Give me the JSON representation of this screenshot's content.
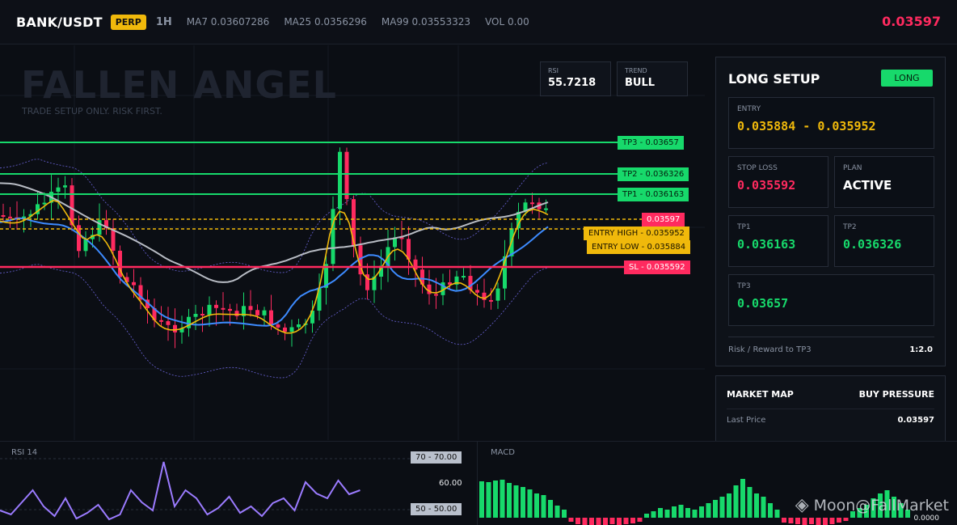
{
  "header": {
    "pair": "BANK/USDT",
    "badge": "PERP",
    "timeframe": "1H",
    "ma7": "MA7 0.03607286",
    "ma25": "MA25 0.0356296",
    "ma99": "MA99 0.03553323",
    "vol": "VOL 0.00",
    "last_price": "0.03597"
  },
  "chart": {
    "watermark_title": "FALLEN ANGEL",
    "watermark_sub": "TRADE SETUP ONLY. RISK FIRST.",
    "rsi_box": {
      "label": "RSI",
      "value": "55.7218"
    },
    "trend_box": {
      "label": "TREND",
      "value": "BULL"
    },
    "levels": {
      "tp3": "TP3 - 0.03657",
      "tp2": "TP2 - 0.036326",
      "tp1": "TP1 - 0.036163",
      "last": "0.03597",
      "entry_high": "ENTRY HIGH - 0.035952",
      "entry_low": "ENTRY LOW - 0.035884",
      "sl": "SL - 0.035592"
    },
    "colors": {
      "bull": "#17d96b",
      "bear": "#ff2a5f",
      "ma7": "#f0b90b",
      "ma25": "#3d8bff",
      "ma99": "#b8bcc4",
      "band": "#6a63d8"
    }
  },
  "setup": {
    "title": "LONG SETUP",
    "direction": "LONG",
    "entry": {
      "label": "ENTRY",
      "value": "0.035884 - 0.035952"
    },
    "stop_loss": {
      "label": "STOP LOSS",
      "value": "0.035592"
    },
    "plan": {
      "label": "PLAN",
      "value": "ACTIVE"
    },
    "tp1": {
      "label": "TP1",
      "value": "0.036163"
    },
    "tp2": {
      "label": "TP2",
      "value": "0.036326"
    },
    "tp3": {
      "label": "TP3",
      "value": "0.03657"
    },
    "rr_label": "Risk / Reward to TP3",
    "rr_value": "1:2.0"
  },
  "market_map": {
    "title": "MARKET MAP",
    "pressure": "BUY PRESSURE",
    "last_price_label": "Last Price",
    "last_price_value": "0.03597"
  },
  "rsi": {
    "label": "RSI 14",
    "tag70": "70 - 70.00",
    "level60": "60.00",
    "tag50": "50 - 50.00",
    "line_color": "#9b7bff"
  },
  "macd": {
    "label": "MACD",
    "zero": "0.0000"
  },
  "credit": {
    "icon": "binance-logo-icon",
    "text": "Moon@FallMarket"
  }
}
